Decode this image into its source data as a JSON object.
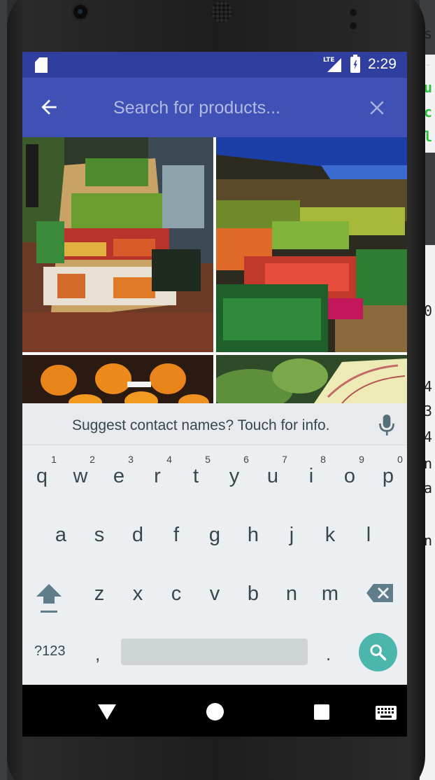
{
  "status_bar": {
    "network": "LTE",
    "time": "2:29"
  },
  "app_bar": {
    "search_placeholder": "Search for products...",
    "search_value": ""
  },
  "product_images": [
    {
      "name": "grocery-stall-vegetables"
    },
    {
      "name": "market-vegetables-under-blue-tarp"
    },
    {
      "name": "oranges-in-crate"
    },
    {
      "name": "leafy-greens"
    }
  ],
  "keyboard": {
    "suggestion": "Suggest contact names? Touch for info.",
    "row1": [
      "q",
      "w",
      "e",
      "r",
      "t",
      "y",
      "u",
      "i",
      "o",
      "p"
    ],
    "row1_hints": [
      "1",
      "2",
      "3",
      "4",
      "5",
      "6",
      "7",
      "8",
      "9",
      "0"
    ],
    "row2": [
      "a",
      "s",
      "d",
      "f",
      "g",
      "h",
      "j",
      "k",
      "l"
    ],
    "row3": [
      "z",
      "x",
      "c",
      "v",
      "b",
      "n",
      "m"
    ],
    "symbols_label": "?123",
    "comma": ",",
    "period": ".",
    "accent_color": "#4db6ac"
  },
  "ide_background": {
    "glyphs": [
      "s",
      "-",
      "u",
      "c",
      "l",
      "0",
      "4",
      "3",
      "4",
      "n",
      "a",
      "n"
    ]
  },
  "colors": {
    "status_bar": "#303f9f",
    "app_bar": "#3f51b5",
    "keyboard_bg": "#eceff1"
  }
}
